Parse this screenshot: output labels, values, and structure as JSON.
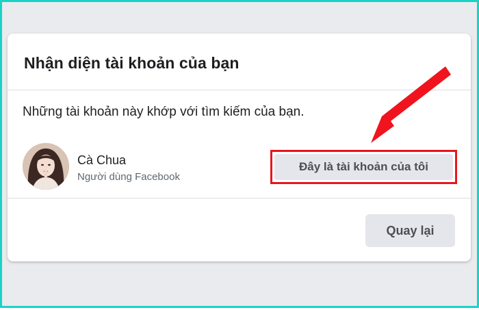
{
  "dialog": {
    "title": "Nhận diện tài khoản của bạn",
    "description": "Những tài khoản này khớp với tìm kiếm của bạn."
  },
  "account": {
    "name": "Cà Chua",
    "subtitle": "Người dùng Facebook"
  },
  "buttons": {
    "confirm_label": "Đây là tài khoản của tôi",
    "back_label": "Quay lại"
  },
  "colors": {
    "frame_border": "#19d3c5",
    "page_background": "#e9ebee",
    "highlight": "#e8141d",
    "button_background": "#e4e6eb"
  },
  "icons": {
    "annotation_arrow": "red-arrow-icon",
    "profile_picture": "avatar"
  }
}
